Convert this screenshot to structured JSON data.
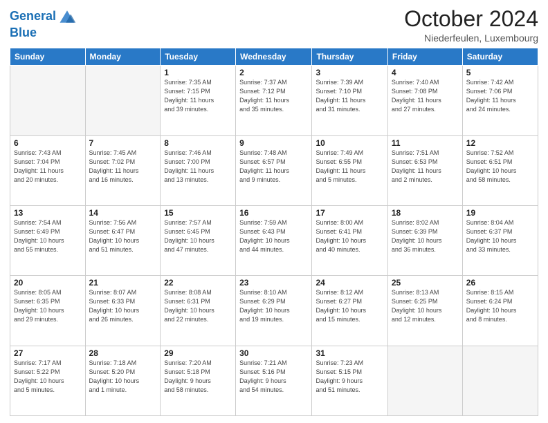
{
  "logo": {
    "line1": "General",
    "line2": "Blue"
  },
  "title": "October 2024",
  "location": "Niederfeulen, Luxembourg",
  "weekdays": [
    "Sunday",
    "Monday",
    "Tuesday",
    "Wednesday",
    "Thursday",
    "Friday",
    "Saturday"
  ],
  "weeks": [
    [
      {
        "day": "",
        "detail": ""
      },
      {
        "day": "",
        "detail": ""
      },
      {
        "day": "1",
        "detail": "Sunrise: 7:35 AM\nSunset: 7:15 PM\nDaylight: 11 hours\nand 39 minutes."
      },
      {
        "day": "2",
        "detail": "Sunrise: 7:37 AM\nSunset: 7:12 PM\nDaylight: 11 hours\nand 35 minutes."
      },
      {
        "day": "3",
        "detail": "Sunrise: 7:39 AM\nSunset: 7:10 PM\nDaylight: 11 hours\nand 31 minutes."
      },
      {
        "day": "4",
        "detail": "Sunrise: 7:40 AM\nSunset: 7:08 PM\nDaylight: 11 hours\nand 27 minutes."
      },
      {
        "day": "5",
        "detail": "Sunrise: 7:42 AM\nSunset: 7:06 PM\nDaylight: 11 hours\nand 24 minutes."
      }
    ],
    [
      {
        "day": "6",
        "detail": "Sunrise: 7:43 AM\nSunset: 7:04 PM\nDaylight: 11 hours\nand 20 minutes."
      },
      {
        "day": "7",
        "detail": "Sunrise: 7:45 AM\nSunset: 7:02 PM\nDaylight: 11 hours\nand 16 minutes."
      },
      {
        "day": "8",
        "detail": "Sunrise: 7:46 AM\nSunset: 7:00 PM\nDaylight: 11 hours\nand 13 minutes."
      },
      {
        "day": "9",
        "detail": "Sunrise: 7:48 AM\nSunset: 6:57 PM\nDaylight: 11 hours\nand 9 minutes."
      },
      {
        "day": "10",
        "detail": "Sunrise: 7:49 AM\nSunset: 6:55 PM\nDaylight: 11 hours\nand 5 minutes."
      },
      {
        "day": "11",
        "detail": "Sunrise: 7:51 AM\nSunset: 6:53 PM\nDaylight: 11 hours\nand 2 minutes."
      },
      {
        "day": "12",
        "detail": "Sunrise: 7:52 AM\nSunset: 6:51 PM\nDaylight: 10 hours\nand 58 minutes."
      }
    ],
    [
      {
        "day": "13",
        "detail": "Sunrise: 7:54 AM\nSunset: 6:49 PM\nDaylight: 10 hours\nand 55 minutes."
      },
      {
        "day": "14",
        "detail": "Sunrise: 7:56 AM\nSunset: 6:47 PM\nDaylight: 10 hours\nand 51 minutes."
      },
      {
        "day": "15",
        "detail": "Sunrise: 7:57 AM\nSunset: 6:45 PM\nDaylight: 10 hours\nand 47 minutes."
      },
      {
        "day": "16",
        "detail": "Sunrise: 7:59 AM\nSunset: 6:43 PM\nDaylight: 10 hours\nand 44 minutes."
      },
      {
        "day": "17",
        "detail": "Sunrise: 8:00 AM\nSunset: 6:41 PM\nDaylight: 10 hours\nand 40 minutes."
      },
      {
        "day": "18",
        "detail": "Sunrise: 8:02 AM\nSunset: 6:39 PM\nDaylight: 10 hours\nand 36 minutes."
      },
      {
        "day": "19",
        "detail": "Sunrise: 8:04 AM\nSunset: 6:37 PM\nDaylight: 10 hours\nand 33 minutes."
      }
    ],
    [
      {
        "day": "20",
        "detail": "Sunrise: 8:05 AM\nSunset: 6:35 PM\nDaylight: 10 hours\nand 29 minutes."
      },
      {
        "day": "21",
        "detail": "Sunrise: 8:07 AM\nSunset: 6:33 PM\nDaylight: 10 hours\nand 26 minutes."
      },
      {
        "day": "22",
        "detail": "Sunrise: 8:08 AM\nSunset: 6:31 PM\nDaylight: 10 hours\nand 22 minutes."
      },
      {
        "day": "23",
        "detail": "Sunrise: 8:10 AM\nSunset: 6:29 PM\nDaylight: 10 hours\nand 19 minutes."
      },
      {
        "day": "24",
        "detail": "Sunrise: 8:12 AM\nSunset: 6:27 PM\nDaylight: 10 hours\nand 15 minutes."
      },
      {
        "day": "25",
        "detail": "Sunrise: 8:13 AM\nSunset: 6:25 PM\nDaylight: 10 hours\nand 12 minutes."
      },
      {
        "day": "26",
        "detail": "Sunrise: 8:15 AM\nSunset: 6:24 PM\nDaylight: 10 hours\nand 8 minutes."
      }
    ],
    [
      {
        "day": "27",
        "detail": "Sunrise: 7:17 AM\nSunset: 5:22 PM\nDaylight: 10 hours\nand 5 minutes."
      },
      {
        "day": "28",
        "detail": "Sunrise: 7:18 AM\nSunset: 5:20 PM\nDaylight: 10 hours\nand 1 minute."
      },
      {
        "day": "29",
        "detail": "Sunrise: 7:20 AM\nSunset: 5:18 PM\nDaylight: 9 hours\nand 58 minutes."
      },
      {
        "day": "30",
        "detail": "Sunrise: 7:21 AM\nSunset: 5:16 PM\nDaylight: 9 hours\nand 54 minutes."
      },
      {
        "day": "31",
        "detail": "Sunrise: 7:23 AM\nSunset: 5:15 PM\nDaylight: 9 hours\nand 51 minutes."
      },
      {
        "day": "",
        "detail": ""
      },
      {
        "day": "",
        "detail": ""
      }
    ]
  ]
}
